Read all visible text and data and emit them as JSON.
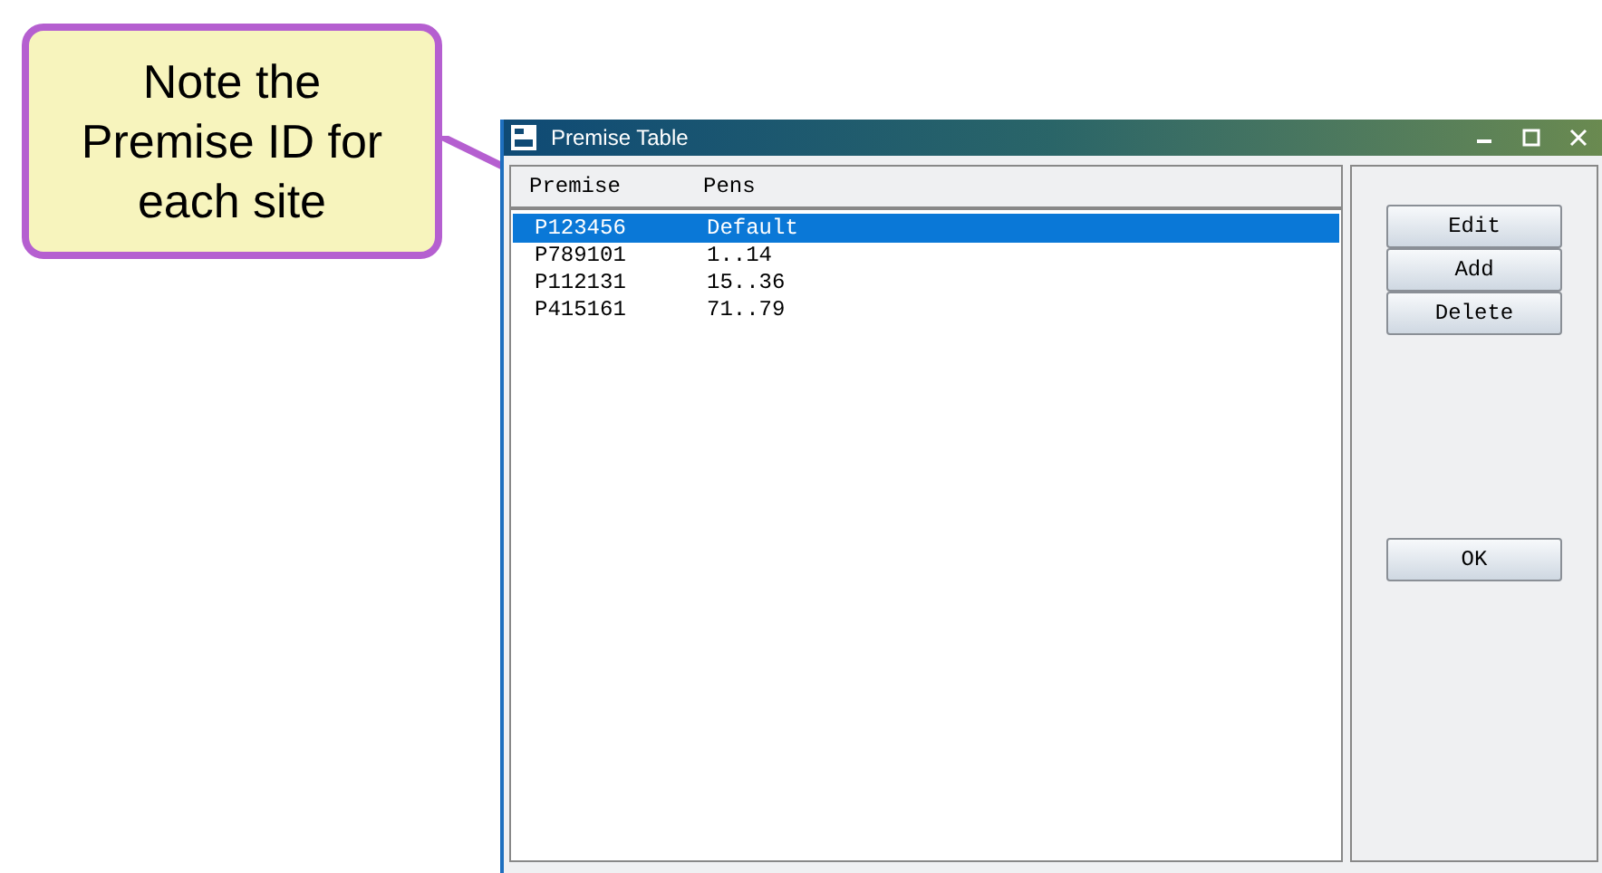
{
  "callout": {
    "text": "Note the Premise ID for each site"
  },
  "window": {
    "title": "Premise Table"
  },
  "table": {
    "columns": [
      "Premise",
      "Pens"
    ],
    "rows": [
      {
        "cells": [
          "P123456",
          "Default"
        ],
        "selected": true
      },
      {
        "cells": [
          "P789101",
          "1..14"
        ],
        "selected": false
      },
      {
        "cells": [
          "P112131",
          "15..36"
        ],
        "selected": false
      },
      {
        "cells": [
          "P415161",
          "71..79"
        ],
        "selected": false
      }
    ]
  },
  "buttons": [
    "Edit",
    "Add",
    "Delete"
  ],
  "ok_button": "OK"
}
